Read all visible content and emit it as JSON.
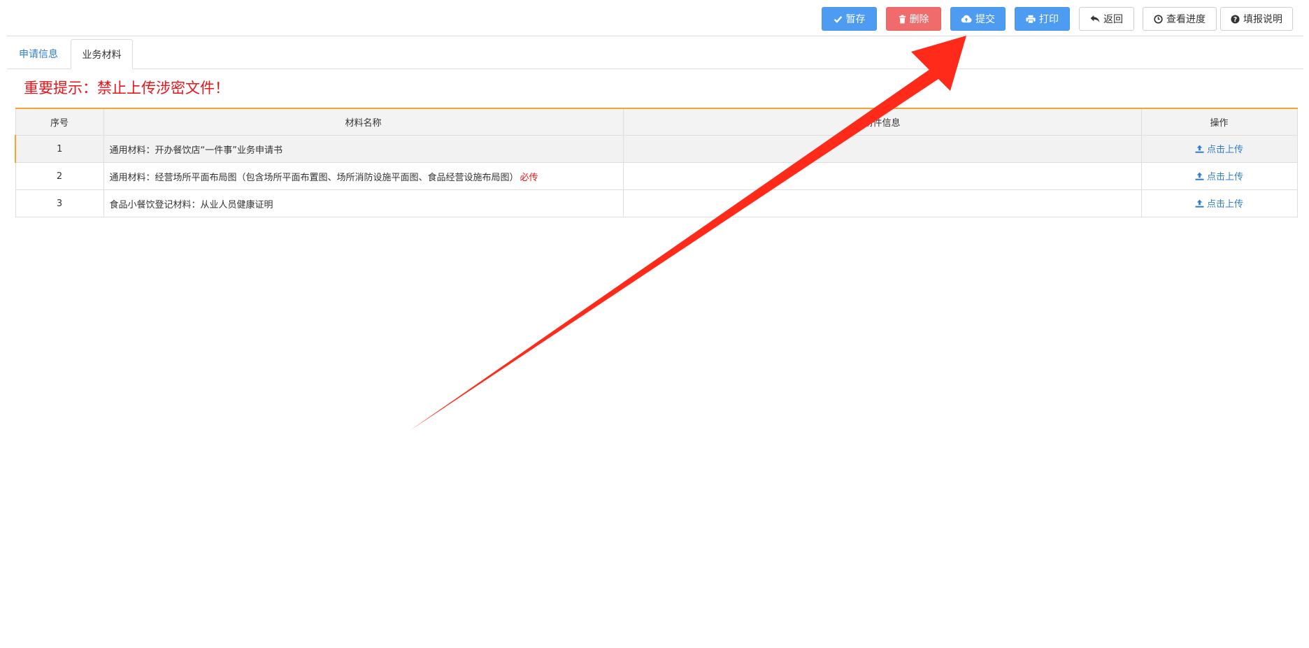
{
  "toolbar": {
    "save": "暂存",
    "delete": "删除",
    "submit": "提交",
    "print": "打印",
    "back": "返回",
    "progress": "查看进度",
    "guide": "填报说明"
  },
  "tabs": {
    "application_info": "申请信息",
    "business_materials": "业务材料"
  },
  "notice": "重要提示：禁止上传涉密文件！",
  "table": {
    "headers": {
      "index": "序号",
      "name": "材料名称",
      "attachment": "附件信息",
      "action": "操作"
    },
    "rows": [
      {
        "index": "1",
        "name": "通用材料：开办餐饮店“一件事”业务申请书",
        "required": "",
        "attachment": "",
        "action": "点击上传"
      },
      {
        "index": "2",
        "name": "通用材料：经营场所平面布局图（包含场所平面布置图、场所消防设施平面图、食品经营设施布局图）",
        "required": "必传",
        "attachment": "",
        "action": "点击上传"
      },
      {
        "index": "3",
        "name": "食品小餐饮登记材料：从业人员健康证明",
        "required": "",
        "attachment": "",
        "action": "点击上传"
      }
    ]
  },
  "icons": {
    "save": "check-icon",
    "delete": "trash-icon",
    "submit": "cloud-upload-icon",
    "print": "printer-icon",
    "back": "reply-icon",
    "progress": "clock-icon",
    "guide": "question-circle-icon",
    "upload": "upload-icon",
    "annotation": "red-arrow-annotation"
  },
  "colors": {
    "primary": "#4d9cf1",
    "danger": "#f06c6c",
    "notice_red": "#e8141a",
    "link": "#2f7fd0",
    "table_accent": "#f2a534",
    "annotation_arrow": "#ff2a1a"
  }
}
